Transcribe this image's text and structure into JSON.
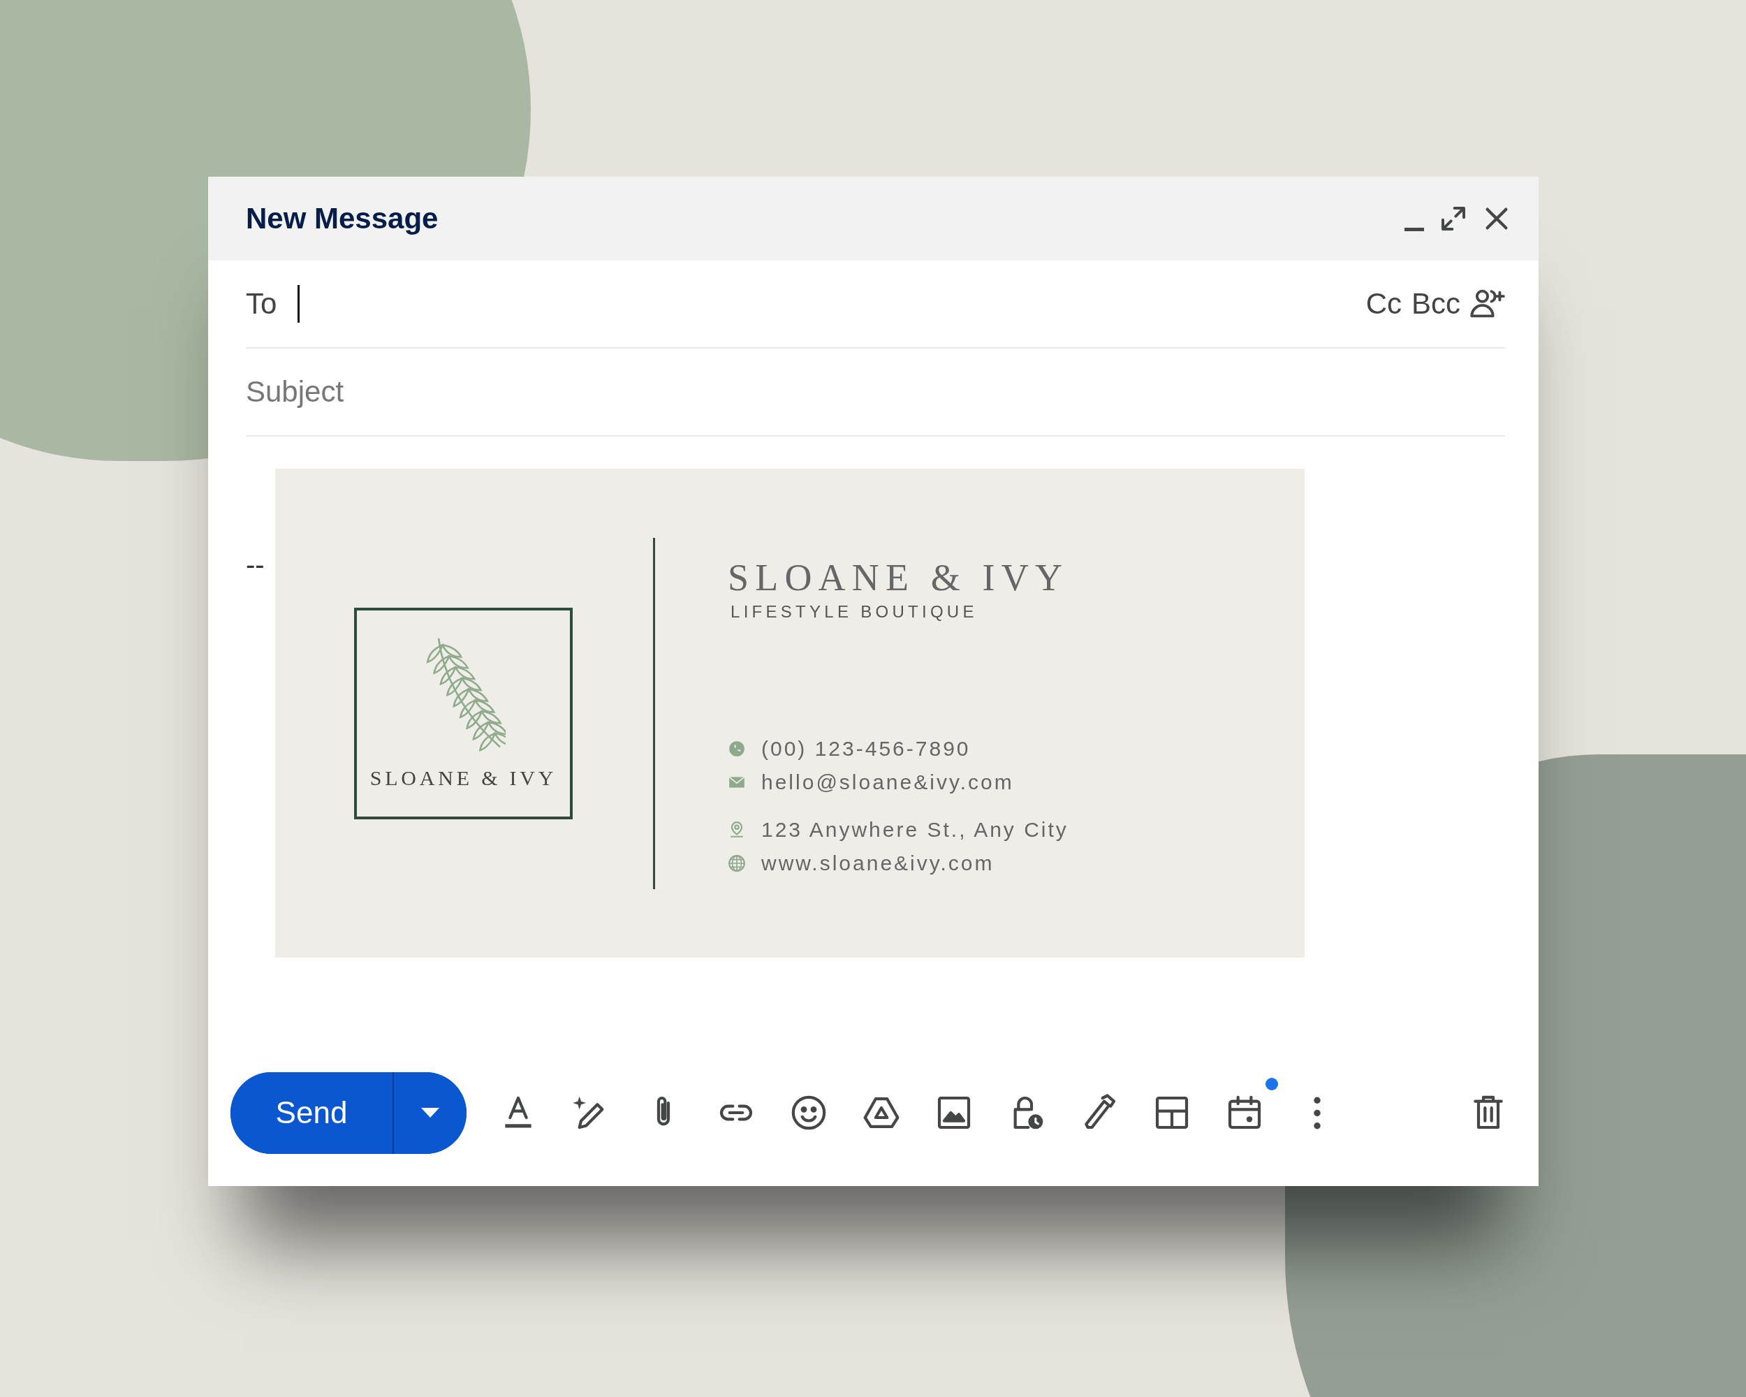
{
  "window": {
    "title": "New Message"
  },
  "recipients": {
    "label": "To",
    "links": [
      "Cc",
      "Bcc"
    ]
  },
  "subject": {
    "placeholder": "Subject"
  },
  "body": {
    "separator": "--",
    "signature": {
      "logo_text": "SLOANE & IVY",
      "name": "SLOANE & IVY",
      "tagline": "LIFESTYLE BOUTIQUE",
      "contact_groups": [
        [
          {
            "kind": "phone",
            "text": "(00) 123-456-7890"
          },
          {
            "kind": "email",
            "text": "hello@sloane&ivy.com"
          }
        ],
        [
          {
            "kind": "address",
            "text": "123 Anywhere St., Any City"
          },
          {
            "kind": "website",
            "text": "www.sloane&ivy.com"
          }
        ]
      ]
    }
  },
  "toolbar": {
    "send": "Send",
    "tools": [
      {
        "kind": "format",
        "dot": false
      },
      {
        "kind": "ai-write",
        "dot": false
      },
      {
        "kind": "attach",
        "dot": false
      },
      {
        "kind": "link",
        "dot": false
      },
      {
        "kind": "emoji",
        "dot": false
      },
      {
        "kind": "drive",
        "dot": false
      },
      {
        "kind": "photo",
        "dot": false
      },
      {
        "kind": "confidential",
        "dot": false
      },
      {
        "kind": "signature",
        "dot": false
      },
      {
        "kind": "layout",
        "dot": false
      },
      {
        "kind": "schedule",
        "dot": true
      },
      {
        "kind": "more",
        "dot": false
      }
    ]
  }
}
